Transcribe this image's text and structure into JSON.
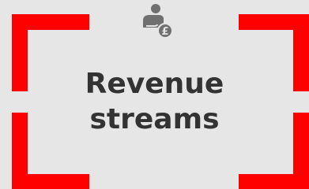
{
  "card": {
    "title_line1": "Revenue",
    "title_line2": "streams",
    "icon": "person-pound-icon",
    "accent_color": "#ff0000",
    "text_color": "#333333",
    "icon_color": "#707070",
    "background_color": "#e6e6e6"
  }
}
